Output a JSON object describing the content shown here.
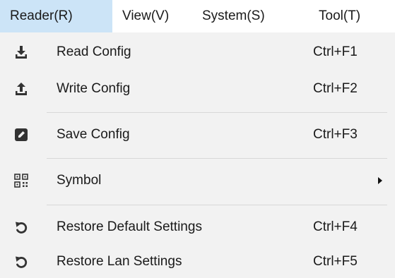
{
  "menubar": {
    "items": [
      {
        "label": "Reader(R)",
        "active": true
      },
      {
        "label": "View(V)",
        "active": false
      },
      {
        "label": "System(S)",
        "active": false
      },
      {
        "label": "Tool(T)",
        "active": false
      }
    ]
  },
  "dropdown": {
    "items": [
      {
        "label": "Read Config",
        "shortcut": "Ctrl+F1",
        "icon": "download-icon"
      },
      {
        "label": "Write Config",
        "shortcut": "Ctrl+F2",
        "icon": "upload-icon"
      },
      {
        "label": "Save Config",
        "shortcut": "Ctrl+F3",
        "icon": "edit-icon"
      },
      {
        "label": "Symbol",
        "shortcut": "",
        "icon": "qr-code-icon",
        "submenu": true
      },
      {
        "label": "Restore Default Settings",
        "shortcut": "Ctrl+F4",
        "icon": "undo-icon"
      },
      {
        "label": "Restore Lan Settings",
        "shortcut": "Ctrl+F5",
        "icon": "undo-icon"
      }
    ]
  },
  "colors": {
    "active_menu_bg": "#cce4f7",
    "dropdown_bg": "#f2f2f2",
    "separator": "#d8d8d8",
    "text": "#1a1a1a"
  }
}
